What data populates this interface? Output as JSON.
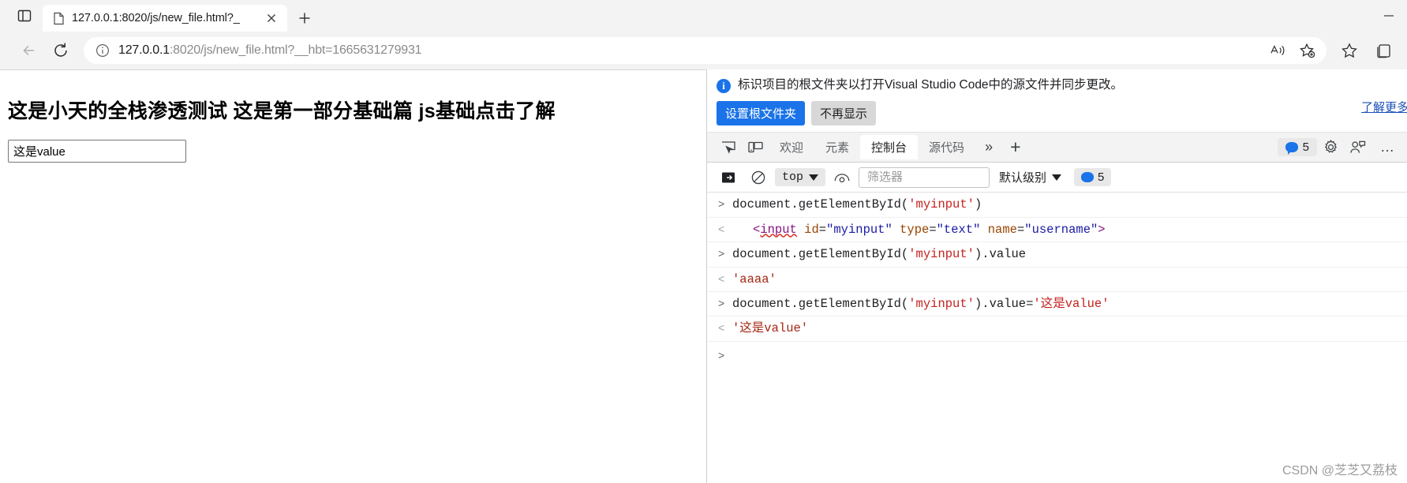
{
  "browser": {
    "tab": {
      "title": "127.0.0.1:8020/js/new_file.html?_",
      "favicon_name": "page-icon",
      "close_label": "×"
    },
    "new_tab_label": "+",
    "window_controls": {
      "minimize": "–"
    },
    "address_bar": {
      "host": "127.0.0.1",
      "rest": ":8020/js/new_file.html?__hbt=1665631279931",
      "full_url": "127.0.0.1:8020/js/new_file.html?__hbt=1665631279931"
    },
    "nav": {
      "back_label": "←",
      "reload_label": "↻"
    }
  },
  "page": {
    "heading": "这是小天的全栈渗透测试 这是第一部分基础篇 js基础点击了解",
    "input_value": "这是value",
    "input_id": "myinput"
  },
  "devtools": {
    "banner": {
      "icon": "i",
      "message": "标识项目的根文件夹以打开Visual Studio Code中的源文件并同步更改。",
      "primary_button": "设置根文件夹",
      "secondary_button": "不再显示",
      "link": "了解更多",
      "accent_color": "#1a73e8"
    },
    "tabs": [
      {
        "label": "欢迎",
        "active": false
      },
      {
        "label": "元素",
        "active": false
      },
      {
        "label": "控制台",
        "active": true
      },
      {
        "label": "源代码",
        "active": false
      }
    ],
    "tabbar": {
      "inspect_icon": "inspect-element-icon",
      "device_icon": "device-toolbar-icon",
      "more_tabs": "»",
      "add_tab": "+",
      "message_count": "5",
      "settings_icon": "gear-icon",
      "feedback_icon": "feedback-icon",
      "overflow": "…"
    },
    "console_toolbar": {
      "sidebar_icon": "console-sidebar-icon",
      "clear_icon": "clear-console-icon",
      "context": "top",
      "eye_icon": "live-expression-icon",
      "filter_placeholder": "筛选器",
      "level": "默认级别",
      "issues_count": "5"
    },
    "log": [
      {
        "dir": "in",
        "type": "command",
        "parts": [
          {
            "t": "document.getElementById(",
            "c": "plain"
          },
          {
            "t": "'myinput'",
            "c": "str"
          },
          {
            "t": ")",
            "c": "plain"
          }
        ]
      },
      {
        "dir": "out",
        "type": "html",
        "indent": true,
        "parts": [
          {
            "t": "<",
            "c": "tag"
          },
          {
            "t": "input",
            "c": "tag-squiggle"
          },
          {
            "t": " ",
            "c": "plain"
          },
          {
            "t": "id",
            "c": "attr"
          },
          {
            "t": "=",
            "c": "punct"
          },
          {
            "t": "\"myinput\"",
            "c": "attrval"
          },
          {
            "t": " ",
            "c": "plain"
          },
          {
            "t": "type",
            "c": "attr"
          },
          {
            "t": "=",
            "c": "punct"
          },
          {
            "t": "\"text\"",
            "c": "attrval"
          },
          {
            "t": " ",
            "c": "plain"
          },
          {
            "t": "name",
            "c": "attr"
          },
          {
            "t": "=",
            "c": "punct"
          },
          {
            "t": "\"username\"",
            "c": "attrval"
          },
          {
            "t": ">",
            "c": "tag"
          }
        ]
      },
      {
        "dir": "in",
        "type": "command",
        "parts": [
          {
            "t": "document.getElementById(",
            "c": "plain"
          },
          {
            "t": "'myinput'",
            "c": "str"
          },
          {
            "t": ").value",
            "c": "plain"
          }
        ]
      },
      {
        "dir": "out",
        "type": "value",
        "parts": [
          {
            "t": "'aaaa'",
            "c": "strq"
          }
        ]
      },
      {
        "dir": "in",
        "type": "command",
        "parts": [
          {
            "t": "document.getElementById(",
            "c": "plain"
          },
          {
            "t": "'myinput'",
            "c": "str"
          },
          {
            "t": ").value=",
            "c": "plain"
          },
          {
            "t": "'这是value'",
            "c": "str"
          }
        ]
      },
      {
        "dir": "out",
        "type": "value",
        "parts": [
          {
            "t": "'这是value'",
            "c": "strq"
          }
        ]
      }
    ],
    "prompt": ">"
  },
  "watermark": "CSDN @芝芝又荔枝"
}
